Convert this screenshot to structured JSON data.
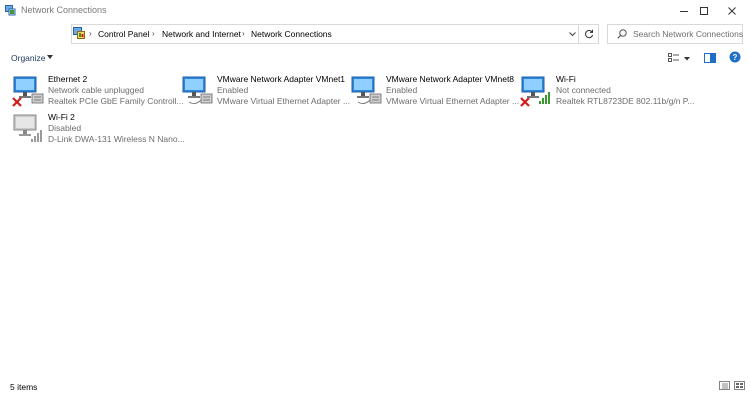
{
  "window": {
    "title": "Network Connections",
    "controls": [
      "minimize",
      "maximize",
      "close"
    ]
  },
  "nav": {
    "back_icon": "back-arrow-icon",
    "forward_icon": "forward-arrow-icon",
    "up_icon": "up-arrow-icon"
  },
  "address": {
    "breadcrumbs": [
      "Control Panel",
      "Network and Internet",
      "Network Connections"
    ]
  },
  "search": {
    "placeholder": "Search Network Connections"
  },
  "toolbar": {
    "organize_label": "Organize"
  },
  "items": [
    {
      "name": "Ethernet 2",
      "status": "Network cable unplugged",
      "device": "Realtek PCIe GbE Family Controll...",
      "kind": "ethernet",
      "badge": "red-x"
    },
    {
      "name": "VMware Network Adapter VMnet1",
      "status": "Enabled",
      "device": "VMware Virtual Ethernet Adapter ...",
      "kind": "ethernet",
      "badge": "none"
    },
    {
      "name": "VMware Network Adapter VMnet8",
      "status": "Enabled",
      "device": "VMware Virtual Ethernet Adapter ...",
      "kind": "ethernet",
      "badge": "none"
    },
    {
      "name": "Wi-Fi",
      "status": "Not connected",
      "device": "Realtek RTL8723DE 802.11b/g/n P...",
      "kind": "wifi",
      "badge": "red-x"
    },
    {
      "name": "Wi-Fi 2",
      "status": "Disabled",
      "device": "D-Link DWA-131 Wireless N Nano...",
      "kind": "wifi-disabled",
      "badge": "none"
    }
  ],
  "statusbar": {
    "count_text": "5 items"
  },
  "colors": {
    "accent_blue": "#1e6fc9",
    "error_red": "#d01c1c",
    "signal_green": "#3a9a2e",
    "disabled_gray": "#9a9a9a"
  }
}
